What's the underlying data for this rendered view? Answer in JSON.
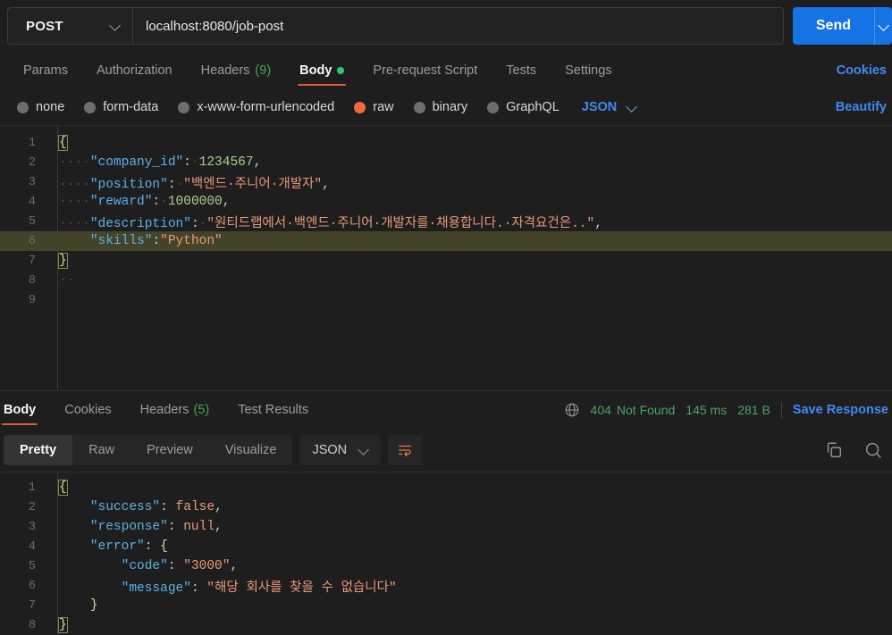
{
  "urlbar": {
    "method": "POST",
    "url": "localhost:8080/job-post",
    "send_label": "Send",
    "method_chevron_icon": "chevron-down-icon",
    "send_chevron_icon": "chevron-down-icon",
    "accent_blue": "#1573e6"
  },
  "request_tabs": {
    "items": [
      {
        "label": "Params",
        "count": "",
        "active": false,
        "dot": false
      },
      {
        "label": "Authorization",
        "count": "",
        "active": false,
        "dot": false
      },
      {
        "label": "Headers",
        "count": "(9)",
        "active": false,
        "dot": false
      },
      {
        "label": "Body",
        "count": "",
        "active": true,
        "dot": true
      },
      {
        "label": "Pre-request Script",
        "count": "",
        "active": false,
        "dot": false
      },
      {
        "label": "Tests",
        "count": "",
        "active": false,
        "dot": false
      },
      {
        "label": "Settings",
        "count": "",
        "active": false,
        "dot": false
      }
    ],
    "cookies_label": "Cookies"
  },
  "body_type": {
    "options": [
      {
        "label": "none",
        "selected": false
      },
      {
        "label": "form-data",
        "selected": false
      },
      {
        "label": "x-www-form-urlencoded",
        "selected": false
      },
      {
        "label": "raw",
        "selected": true
      },
      {
        "label": "binary",
        "selected": false
      },
      {
        "label": "GraphQL",
        "selected": false
      }
    ],
    "format": "JSON",
    "format_chevron_icon": "chevron-down-icon",
    "beautify_label": "Beautify"
  },
  "request_body": {
    "language": "json",
    "highlighted_line": 6,
    "lines": [
      {
        "n": 1,
        "tokens": [
          {
            "t": "{",
            "c": "br br-box"
          }
        ]
      },
      {
        "n": 2,
        "tokens": [
          {
            "t": "····",
            "c": "ws"
          },
          {
            "t": "\"company_id\"",
            "c": "k"
          },
          {
            "t": ":",
            "c": "p"
          },
          {
            "t": "·",
            "c": "ws"
          },
          {
            "t": "1234567",
            "c": "n"
          },
          {
            "t": ",",
            "c": "p"
          }
        ]
      },
      {
        "n": 3,
        "tokens": [
          {
            "t": "····",
            "c": "ws"
          },
          {
            "t": "\"position\"",
            "c": "k"
          },
          {
            "t": ":",
            "c": "p"
          },
          {
            "t": "·",
            "c": "ws"
          },
          {
            "t": "\"백엔드·주니어·개발자\"",
            "c": "s"
          },
          {
            "t": ",",
            "c": "p"
          }
        ]
      },
      {
        "n": 4,
        "tokens": [
          {
            "t": "····",
            "c": "ws"
          },
          {
            "t": "\"reward\"",
            "c": "k"
          },
          {
            "t": ":",
            "c": "p"
          },
          {
            "t": "·",
            "c": "ws"
          },
          {
            "t": "1000000",
            "c": "n"
          },
          {
            "t": ",",
            "c": "p"
          }
        ]
      },
      {
        "n": 5,
        "tokens": [
          {
            "t": "····",
            "c": "ws"
          },
          {
            "t": "\"description\"",
            "c": "k"
          },
          {
            "t": ":",
            "c": "p"
          },
          {
            "t": "·",
            "c": "ws"
          },
          {
            "t": "\"원티드랩에서·백엔드·주니어·개발자를·채용합니다.·자격요건은..\"",
            "c": "s"
          },
          {
            "t": ",",
            "c": "p"
          }
        ]
      },
      {
        "n": 6,
        "tokens": [
          {
            "t": "    ",
            "c": "ws"
          },
          {
            "t": "\"skills\"",
            "c": "k"
          },
          {
            "t": ":",
            "c": "p"
          },
          {
            "t": "\"Python\"",
            "c": "s"
          }
        ]
      },
      {
        "n": 7,
        "tokens": [
          {
            "t": "}",
            "c": "br br-box"
          }
        ]
      },
      {
        "n": 8,
        "tokens": [
          {
            "t": "··",
            "c": "ws"
          }
        ]
      },
      {
        "n": 9,
        "tokens": []
      }
    ]
  },
  "response_tabs": {
    "items": [
      {
        "label": "Body",
        "count": "",
        "active": true
      },
      {
        "label": "Cookies",
        "count": "",
        "active": false
      },
      {
        "label": "Headers",
        "count": "(5)",
        "active": false
      },
      {
        "label": "Test Results",
        "count": "",
        "active": false
      }
    ],
    "globe_icon": "globe-icon",
    "status_code": "404",
    "status_text": "Not Found",
    "time": "145 ms",
    "size": "281 B",
    "status_color": "#4aa564",
    "save_response_label": "Save Response"
  },
  "response_toolbar": {
    "view_modes": [
      {
        "label": "Pretty",
        "active": true
      },
      {
        "label": "Raw",
        "active": false
      },
      {
        "label": "Preview",
        "active": false
      },
      {
        "label": "Visualize",
        "active": false
      }
    ],
    "format": "JSON",
    "format_chevron_icon": "chevron-down-icon",
    "wrap_icon": "word-wrap-icon",
    "copy_icon": "copy-icon",
    "search_icon": "search-icon"
  },
  "response_body": {
    "language": "json",
    "lines": [
      {
        "n": 1,
        "tokens": [
          {
            "t": "{",
            "c": "br br-box"
          }
        ]
      },
      {
        "n": 2,
        "tokens": [
          {
            "t": "    ",
            "c": "ws"
          },
          {
            "t": "\"success\"",
            "c": "k"
          },
          {
            "t": ": ",
            "c": "p"
          },
          {
            "t": "false",
            "c": "b"
          },
          {
            "t": ",",
            "c": "p"
          }
        ]
      },
      {
        "n": 3,
        "tokens": [
          {
            "t": "    ",
            "c": "ws"
          },
          {
            "t": "\"response\"",
            "c": "k"
          },
          {
            "t": ": ",
            "c": "p"
          },
          {
            "t": "null",
            "c": "b"
          },
          {
            "t": ",",
            "c": "p"
          }
        ]
      },
      {
        "n": 4,
        "tokens": [
          {
            "t": "    ",
            "c": "ws"
          },
          {
            "t": "\"error\"",
            "c": "k"
          },
          {
            "t": ": ",
            "c": "p"
          },
          {
            "t": "{",
            "c": "br"
          }
        ]
      },
      {
        "n": 5,
        "tokens": [
          {
            "t": "        ",
            "c": "ws"
          },
          {
            "t": "\"code\"",
            "c": "k"
          },
          {
            "t": ": ",
            "c": "p"
          },
          {
            "t": "\"3000\"",
            "c": "s"
          },
          {
            "t": ",",
            "c": "p"
          }
        ]
      },
      {
        "n": 6,
        "tokens": [
          {
            "t": "        ",
            "c": "ws"
          },
          {
            "t": "\"message\"",
            "c": "k"
          },
          {
            "t": ": ",
            "c": "p"
          },
          {
            "t": "\"해당 회사를 찾을 수 없습니다\"",
            "c": "s"
          }
        ]
      },
      {
        "n": 7,
        "tokens": [
          {
            "t": "    ",
            "c": "ws"
          },
          {
            "t": "}",
            "c": "br"
          }
        ]
      },
      {
        "n": 8,
        "tokens": [
          {
            "t": "}",
            "c": "br br-box"
          }
        ]
      }
    ]
  }
}
